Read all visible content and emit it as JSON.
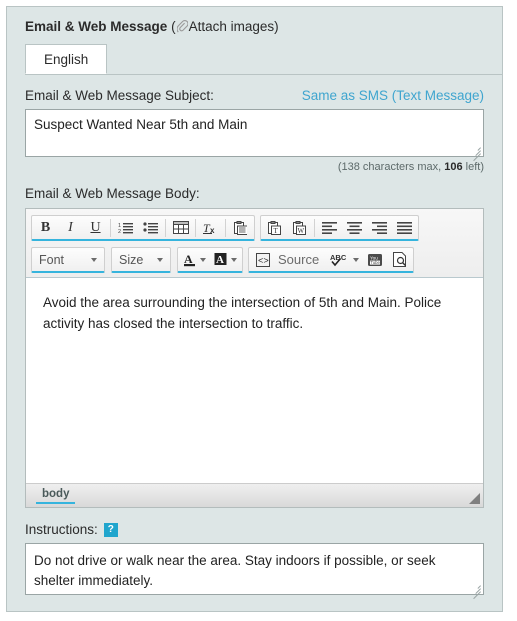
{
  "panel": {
    "header": {
      "title": "Email & Web Message",
      "open_paren": " (",
      "attach_icon": "paperclip-icon",
      "attach_label": "Attach images",
      "close_paren": ")"
    },
    "tabs": [
      {
        "label": "English",
        "active": true
      }
    ]
  },
  "subject": {
    "label": "Email & Web Message Subject:",
    "same_as_sms_link": "Same as SMS (Text Message)",
    "value": "Suspect Wanted Near 5th and Main",
    "placeholder": "",
    "counter_prefix": "(138 characters max, ",
    "counter_remaining": "106",
    "counter_suffix": " left)"
  },
  "body": {
    "label": "Email & Web Message Body:",
    "content": "Avoid the area surrounding the intersection of 5th and Main. Police activity has closed the intersection to traffic.",
    "element_path": "body"
  },
  "toolbar": {
    "row1": [
      {
        "name": "bold-icon",
        "label": "B"
      },
      {
        "name": "italic-icon",
        "label": "I"
      },
      {
        "name": "underline-icon",
        "label": "U"
      },
      {
        "name": "numbered-list-icon",
        "label": ""
      },
      {
        "name": "bulleted-list-icon",
        "label": ""
      },
      {
        "name": "table-icon",
        "label": ""
      },
      {
        "name": "remove-format-icon",
        "label": ""
      },
      {
        "name": "paste-icon",
        "label": ""
      },
      {
        "name": "paste-text-icon",
        "label": ""
      },
      {
        "name": "paste-word-icon",
        "label": ""
      },
      {
        "name": "align-left-icon",
        "label": ""
      },
      {
        "name": "align-center-icon",
        "label": ""
      },
      {
        "name": "align-right-icon",
        "label": ""
      },
      {
        "name": "align-justify-icon",
        "label": ""
      }
    ],
    "font_select": "Font",
    "size_select": "Size",
    "text_color_icon": "text-color-icon",
    "bg_color_icon": "background-color-icon",
    "source_label": "Source",
    "spellcheck_icon": "spellcheck-icon",
    "youtube_icon": "youtube-icon",
    "preview_icon": "preview-icon"
  },
  "instructions": {
    "label": "Instructions:",
    "help_icon": "help-icon",
    "help_glyph": "?",
    "value": "Do not drive or walk near the area. Stay indoors if possible, or seek shelter immediately.",
    "placeholder": ""
  },
  "colors": {
    "panel_bg": "#dde6e6",
    "accent_cyan": "#35b4dd",
    "link_blue": "#3fa5cf",
    "help_badge": "#1fa5cd",
    "border_grey": "#b9c4c4"
  }
}
